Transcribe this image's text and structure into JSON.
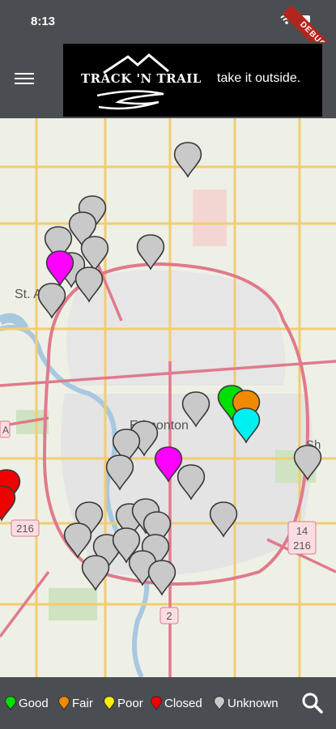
{
  "status": {
    "time": "8:13",
    "debug_label": "DEBUG"
  },
  "app": {
    "logo_title": "TRACK 'N TRAIL",
    "tagline": "take it outside."
  },
  "map": {
    "place_labels": {
      "st_albert": "St. Al",
      "edmonton": "Edmonton",
      "sherwood": "Sh"
    },
    "highway_shields": [
      "216",
      "14",
      "216",
      "216",
      "2",
      "A"
    ],
    "markers": [
      {
        "status": "unknown",
        "color": "#c9c9c9"
      },
      {
        "status": "poor",
        "color": "#ff00ff"
      },
      {
        "status": "good",
        "color": "#00e000"
      },
      {
        "status": "fair",
        "color": "#f08a00"
      },
      {
        "status": "cyan",
        "color": "#00f0f0"
      },
      {
        "status": "closed",
        "color": "#f00000"
      }
    ]
  },
  "legend": {
    "items": [
      {
        "label": "Good",
        "color": "#00e000"
      },
      {
        "label": "Fair",
        "color": "#f08a00"
      },
      {
        "label": "Poor",
        "color": "#f8f000"
      },
      {
        "label": "Closed",
        "color": "#f00000"
      },
      {
        "label": "Unknown",
        "color": "#c9c9c9"
      }
    ]
  }
}
